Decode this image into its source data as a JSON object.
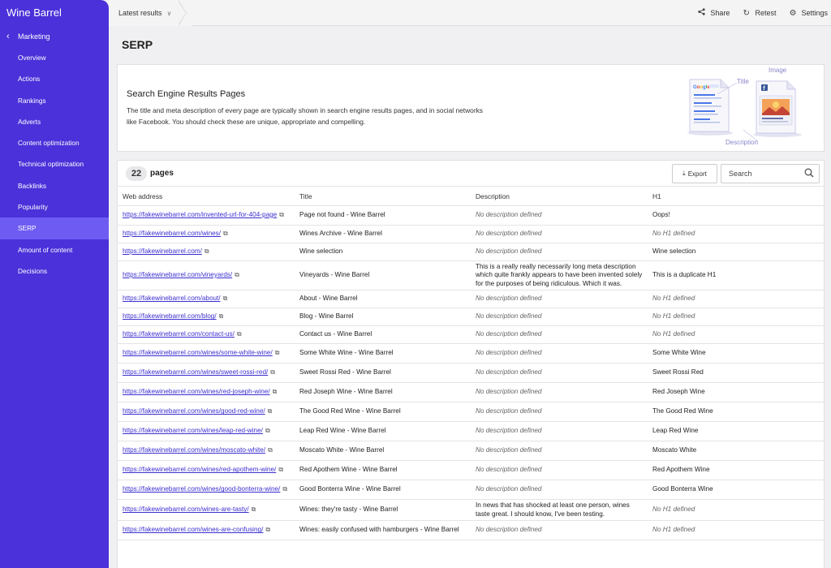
{
  "app": {
    "brand": "Wine Barrel"
  },
  "sidebar": {
    "section": "Marketing",
    "items": [
      {
        "label": "Overview",
        "active": false
      },
      {
        "label": "Actions",
        "active": false
      },
      {
        "label": "Rankings",
        "active": false
      },
      {
        "label": "Adverts",
        "active": false
      },
      {
        "label": "Content optimization",
        "active": false
      },
      {
        "label": "Technical optimization",
        "active": false
      },
      {
        "label": "Backlinks",
        "active": false
      },
      {
        "label": "Popularity",
        "active": false
      },
      {
        "label": "SERP",
        "active": true
      },
      {
        "label": "Amount of content",
        "active": false
      },
      {
        "label": "Decisions",
        "active": false
      }
    ]
  },
  "topbar": {
    "crumb": "Latest results",
    "share": "Share",
    "retest": "Retest",
    "settings": "Settings"
  },
  "page": {
    "title": "SERP"
  },
  "info": {
    "title": "Search Engine Results Pages",
    "description": "The title and meta description of every page are typically shown in search engine results pages, and in social networks like Facebook. You should check these are unique, appropriate and compelling.",
    "illus_title": "Title",
    "illus_image": "Image",
    "illus_description": "Description"
  },
  "table": {
    "count": "22",
    "count_label": "pages",
    "export_label": "Export",
    "search_placeholder": "Search",
    "headers": {
      "url": "Web address",
      "title": "Title",
      "description": "Description",
      "h1": "H1"
    },
    "rows": [
      {
        "url": "https://fakewinebarrel.com/invented-url-for-404-page",
        "title": "Page not found - Wine Barrel",
        "description": "No description defined",
        "desc_missing": true,
        "h1": "Oops!",
        "h1_missing": false
      },
      {
        "url": "https://fakewinebarrel.com/wines/",
        "title": "Wines Archive - Wine Barrel",
        "description": "No description defined",
        "desc_missing": true,
        "h1": "No H1 defined",
        "h1_missing": true
      },
      {
        "url": "https://fakewinebarrel.com/",
        "title": "Wine selection",
        "description": "No description defined",
        "desc_missing": true,
        "h1": "Wine selection",
        "h1_missing": false
      },
      {
        "url": "https://fakewinebarrel.com/vineyards/",
        "title": "Vineyards - Wine Barrel",
        "description": "This is a really really necessarily long meta description which quite frankly appears to have been invented solely for the purposes of being ridiculous. Which it was.",
        "desc_missing": false,
        "h1": "This is a duplicate H1",
        "h1_missing": false
      },
      {
        "url": "https://fakewinebarrel.com/about/",
        "title": "About - Wine Barrel",
        "description": "No description defined",
        "desc_missing": true,
        "h1": "No H1 defined",
        "h1_missing": true
      },
      {
        "url": "https://fakewinebarrel.com/blog/",
        "title": "Blog - Wine Barrel",
        "description": "No description defined",
        "desc_missing": true,
        "h1": "No H1 defined",
        "h1_missing": true
      },
      {
        "url": "https://fakewinebarrel.com/contact-us/",
        "title": "Contact us - Wine Barrel",
        "description": "No description defined",
        "desc_missing": true,
        "h1": "No H1 defined",
        "h1_missing": true
      },
      {
        "url": "https://fakewinebarrel.com/wines/some-white-wine/",
        "title": "Some White Wine - Wine Barrel",
        "description": "No description defined",
        "desc_missing": true,
        "h1": "Some White Wine",
        "h1_missing": false
      },
      {
        "url": "https://fakewinebarrel.com/wines/sweet-rossi-red/",
        "title": "Sweet Rossi Red - Wine Barrel",
        "description": "No description defined",
        "desc_missing": true,
        "h1": "Sweet Rossi Red",
        "h1_missing": false
      },
      {
        "url": "https://fakewinebarrel.com/wines/red-joseph-wine/",
        "title": "Red Joseph Wine - Wine Barrel",
        "description": "No description defined",
        "desc_missing": true,
        "h1": "Red Joseph Wine",
        "h1_missing": false
      },
      {
        "url": "https://fakewinebarrel.com/wines/good-red-wine/",
        "title": "The Good Red Wine - Wine Barrel",
        "description": "No description defined",
        "desc_missing": true,
        "h1": "The Good Red Wine",
        "h1_missing": false
      },
      {
        "url": "https://fakewinebarrel.com/wines/leap-red-wine/",
        "title": "Leap Red Wine - Wine Barrel",
        "description": "No description defined",
        "desc_missing": true,
        "h1": "Leap Red Wine",
        "h1_missing": false
      },
      {
        "url": "https://fakewinebarrel.com/wines/moscato-white/",
        "title": "Moscato White - Wine Barrel",
        "description": "No description defined",
        "desc_missing": true,
        "h1": "Moscato White",
        "h1_missing": false
      },
      {
        "url": "https://fakewinebarrel.com/wines/red-apothem-wine/",
        "title": "Red Apothem Wine - Wine Barrel",
        "description": "No description defined",
        "desc_missing": true,
        "h1": "Red Apothem Wine",
        "h1_missing": false
      },
      {
        "url": "https://fakewinebarrel.com/wines/good-bonterra-wine/",
        "title": "Good Bonterra Wine - Wine Barrel",
        "description": "No description defined",
        "desc_missing": true,
        "h1": "Good Bonterra Wine",
        "h1_missing": false
      },
      {
        "url": "https://fakewinebarrel.com/wines-are-tasty/",
        "title": "Wines: they're tasty - Wine Barrel",
        "description": "In news that has shocked at least one person, wines taste great. I should know, I've been testing.",
        "desc_missing": false,
        "h1": "No H1 defined",
        "h1_missing": true
      },
      {
        "url": "https://fakewinebarrel.com/wines-are-confusing/",
        "title": "Wines: easily confused with hamburgers - Wine Barrel",
        "description": "No description defined",
        "desc_missing": true,
        "h1": "No H1 defined",
        "h1_missing": true
      }
    ]
  },
  "colors": {
    "sidebar": "#4a31d9",
    "sidebar_active": "#6e5cf2",
    "link": "#3b2fd0",
    "accent_illustration": "#8a86c9"
  }
}
